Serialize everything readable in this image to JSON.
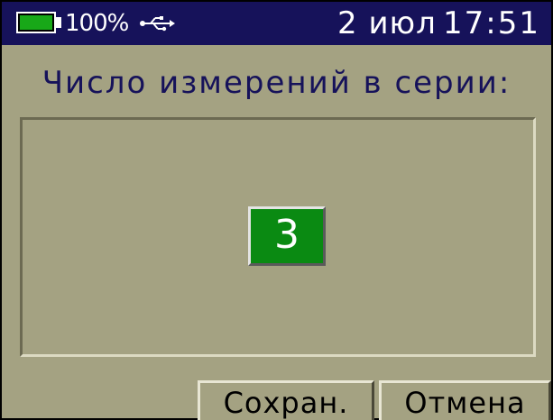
{
  "status_bar": {
    "battery_level": 1.0,
    "battery_percent": "100%",
    "usb_icon": "usb-icon",
    "date": "2 июл",
    "time": "17:51",
    "background_color": "#16125a",
    "battery_color": "#18a818"
  },
  "screen": {
    "heading": "Число измерений в серии:",
    "value": "3",
    "background_color": "#a4a282",
    "value_box_color": "#0a8a12"
  },
  "buttons": {
    "save_label": "Сохран.",
    "cancel_label": "Отмена"
  }
}
